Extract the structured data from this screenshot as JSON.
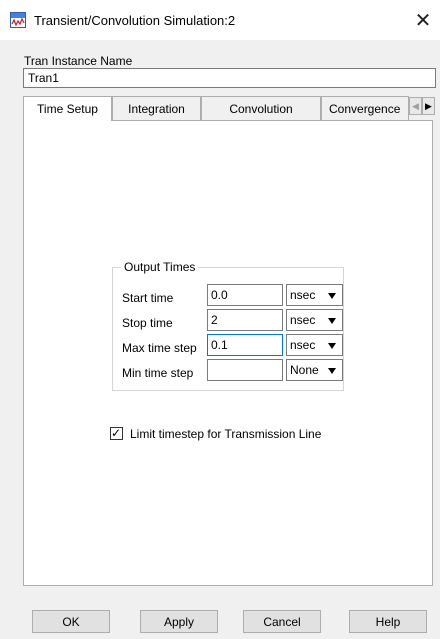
{
  "window": {
    "title": "Transient/Convolution Simulation:2",
    "icon": "simulation-waveform-icon",
    "close_glyph": "✕"
  },
  "instance": {
    "label": "Tran Instance Name",
    "value": "Tran1"
  },
  "tabs": [
    {
      "label": "Time Setup",
      "active": true
    },
    {
      "label": "Integration",
      "active": false
    },
    {
      "label": "Convolution",
      "active": false
    },
    {
      "label": "Convergence",
      "active": false
    }
  ],
  "tab_scroll": {
    "left": "◀",
    "right": "▶"
  },
  "output_times": {
    "title": "Output Times",
    "rows": [
      {
        "label": "Start time",
        "value": "0.0",
        "unit": "nsec"
      },
      {
        "label": "Stop time",
        "value": "2",
        "unit": "nsec"
      },
      {
        "label": "Max time step",
        "value": "0.1",
        "unit": "nsec"
      },
      {
        "label": "Min time step",
        "value": "",
        "unit": "None"
      }
    ]
  },
  "limit_timestep": {
    "label": "Limit timestep for Transmission Line",
    "checked": true,
    "check_glyph": "✓"
  },
  "buttons": {
    "ok": "OK",
    "apply": "Apply",
    "cancel": "Cancel",
    "help": "Help"
  },
  "colors": {
    "focus_border": "#0078d7",
    "dialog_bg": "#f0f0f0"
  }
}
